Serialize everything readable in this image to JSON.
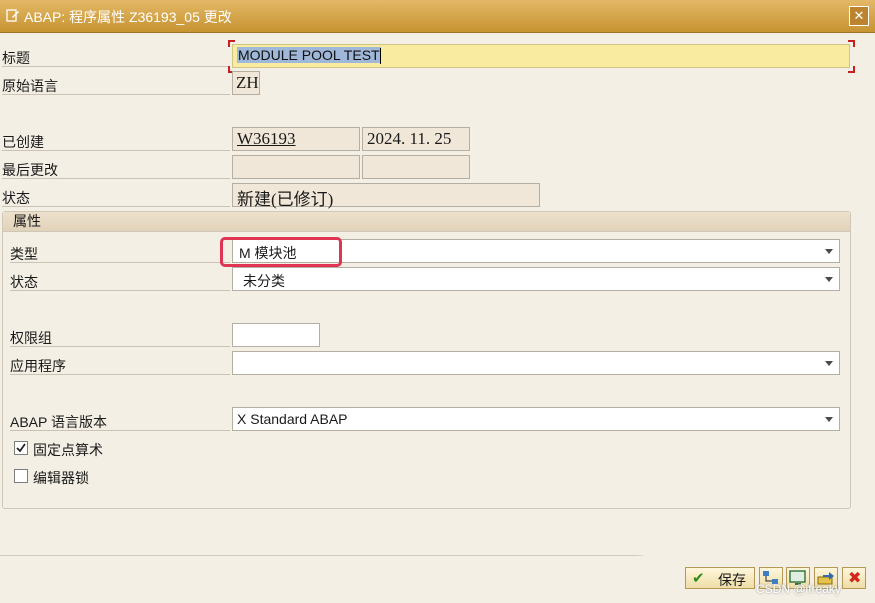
{
  "window": {
    "title": "ABAP: 程序属性 Z36193_05 更改",
    "close_glyph": "✕"
  },
  "fields": {
    "title_label": "标题",
    "title_value": "MODULE POOL TEST",
    "orig_lang_label": "原始语言",
    "orig_lang_value": "ZH",
    "created_label": "已创建",
    "created_by": "W36193",
    "created_date": "2024. 11. 25",
    "last_changed_label": "最后更改",
    "last_changed_by": "",
    "last_changed_date": "",
    "status_label": "状态",
    "status_value": "新建(已修订)"
  },
  "attributes": {
    "group_title": "属性",
    "type_label": "类型",
    "type_value": "M 模块池",
    "status_label": "状态",
    "status_value": "未分类",
    "auth_group_label": "权限组",
    "auth_group_value": "",
    "application_label": "应用程序",
    "application_value": "",
    "abap_version_label": "ABAP 语言版本",
    "abap_version_value": "X Standard ABAP",
    "fixed_point_label": "固定点算术",
    "fixed_point_checked": true,
    "editor_lock_label": "编辑器锁",
    "editor_lock_checked": false
  },
  "buttons": {
    "save_label": "保存",
    "checkmark_glyph": "✔",
    "cancel_glyph": "✖"
  },
  "colors": {
    "titlebar": "#d9a84a",
    "highlight": "#e03552",
    "title_field": "#f9eca0",
    "readonly_field": "#f1e7d9"
  },
  "watermark": "CSDN @ifreaky"
}
